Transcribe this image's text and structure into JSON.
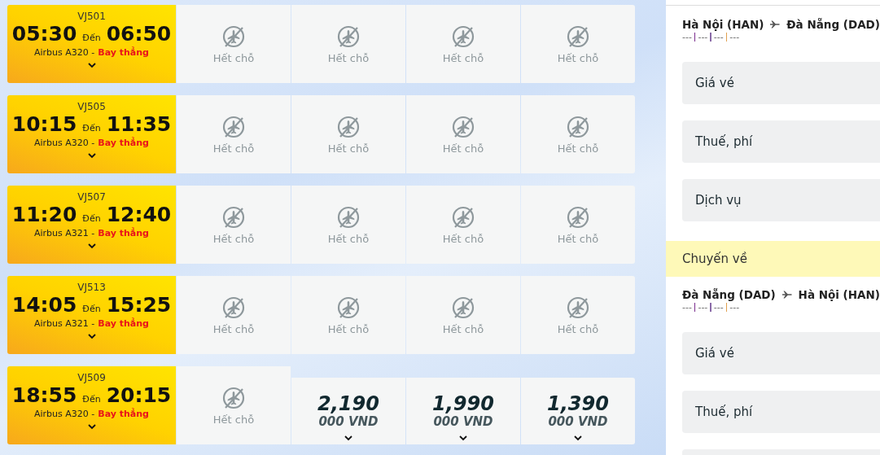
{
  "flights": [
    {
      "code": "VJ501",
      "depart": "05:30",
      "to_word": "Đến",
      "arrive": "06:50",
      "aircraft": "Airbus A320 -",
      "route_type": "Bay thẳng",
      "fares": [
        {
          "kind": "soldout",
          "label": "Hết chỗ"
        },
        {
          "kind": "soldout",
          "label": "Hết chỗ"
        },
        {
          "kind": "soldout",
          "label": "Hết chỗ"
        },
        {
          "kind": "soldout",
          "label": "Hết chỗ"
        }
      ]
    },
    {
      "code": "VJ505",
      "depart": "10:15",
      "to_word": "Đến",
      "arrive": "11:35",
      "aircraft": "Airbus A320 -",
      "route_type": "Bay thẳng",
      "fares": [
        {
          "kind": "soldout",
          "label": "Hết chỗ"
        },
        {
          "kind": "soldout",
          "label": "Hết chỗ"
        },
        {
          "kind": "soldout",
          "label": "Hết chỗ"
        },
        {
          "kind": "soldout",
          "label": "Hết chỗ"
        }
      ]
    },
    {
      "code": "VJ507",
      "depart": "11:20",
      "to_word": "Đến",
      "arrive": "12:40",
      "aircraft": "Airbus A321 -",
      "route_type": "Bay thẳng",
      "fares": [
        {
          "kind": "soldout",
          "label": "Hết chỗ"
        },
        {
          "kind": "soldout",
          "label": "Hết chỗ"
        },
        {
          "kind": "soldout",
          "label": "Hết chỗ"
        },
        {
          "kind": "soldout",
          "label": "Hết chỗ"
        }
      ]
    },
    {
      "code": "VJ513",
      "depart": "14:05",
      "to_word": "Đến",
      "arrive": "15:25",
      "aircraft": "Airbus A321 -",
      "route_type": "Bay thẳng",
      "fares": [
        {
          "kind": "soldout",
          "label": "Hết chỗ"
        },
        {
          "kind": "soldout",
          "label": "Hết chỗ"
        },
        {
          "kind": "soldout",
          "label": "Hết chỗ"
        },
        {
          "kind": "soldout",
          "label": "Hết chỗ"
        }
      ]
    },
    {
      "code": "VJ509",
      "depart": "18:55",
      "to_word": "Đến",
      "arrive": "20:15",
      "aircraft": "Airbus A320 -",
      "route_type": "Bay thẳng",
      "fares": [
        {
          "kind": "soldout",
          "label": "Hết chỗ"
        },
        {
          "kind": "price",
          "price": "2,190",
          "unit": "000 VND"
        },
        {
          "kind": "price",
          "price": "1,990",
          "unit": "000 VND"
        },
        {
          "kind": "price",
          "price": "1,390",
          "unit": "000 VND"
        }
      ]
    }
  ],
  "summary": {
    "outbound": {
      "from": "Hà Nội (HAN)",
      "to": "Đà Nẵng (DAD)",
      "details": [
        "---",
        "---",
        "---",
        "---"
      ],
      "rows": [
        "Giá vé",
        "Thuế, phí",
        "Dịch vụ"
      ]
    },
    "return_heading": "Chuyến về",
    "return": {
      "from": "Đà Nẵng (DAD)",
      "to": "Hà Nội (HAN)",
      "details": [
        "---",
        "---",
        "---",
        "---"
      ],
      "rows": [
        "Giá vé",
        "Thuế, phí"
      ]
    }
  }
}
